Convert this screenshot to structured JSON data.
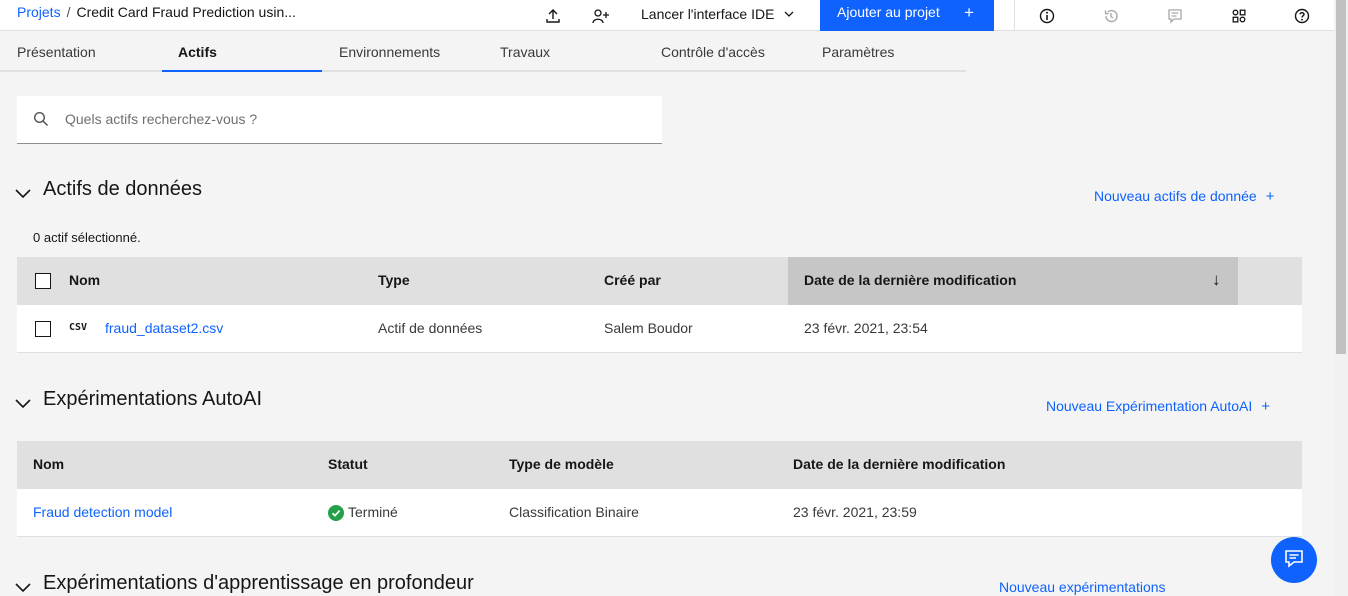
{
  "breadcrumb": {
    "root": "Projets",
    "separator": "/",
    "project": "Credit Card Fraud Prediction usin..."
  },
  "header": {
    "launch_ide": "Lancer l'interface IDE",
    "add_to_project": "Ajouter au projet",
    "add_icon": "+",
    "icons": [
      "upload-icon",
      "add-user-icon",
      "info-icon",
      "history-icon",
      "comment-icon",
      "apps-icon",
      "help-icon"
    ]
  },
  "tabs": [
    {
      "label": "Présentation"
    },
    {
      "label": "Actifs"
    },
    {
      "label": "Environnements"
    },
    {
      "label": "Travaux"
    },
    {
      "label": "Contrôle d'accès"
    },
    {
      "label": "Paramètres"
    }
  ],
  "active_tab": "Actifs",
  "search": {
    "placeholder": "Quels actifs recherchez-vous ?"
  },
  "data_assets": {
    "title": "Actifs de données",
    "new_link": "Nouveau actifs de donnée",
    "plus": "+",
    "selected_count": "0 actif sélectionné.",
    "columns": {
      "name": "Nom",
      "type": "Type",
      "created_by": "Créé par",
      "modified": "Date de la dernière modification"
    },
    "sort_icon": "↓",
    "rows": [
      {
        "badge": "CSV",
        "name": "fraud_dataset2.csv",
        "type": "Actif de données",
        "created_by": "Salem Boudor",
        "modified": "23 févr. 2021, 23:54"
      }
    ]
  },
  "autoai": {
    "title": "Expérimentations AutoAI",
    "new_link": "Nouveau Expérimentation AutoAI",
    "plus": "+",
    "columns": {
      "name": "Nom",
      "status": "Statut",
      "model_type": "Type de modèle",
      "modified": "Date de la dernière modification"
    },
    "rows": [
      {
        "name": "Fraud detection model",
        "status": "Terminé",
        "model_type": "Classification Binaire",
        "modified": "23 févr. 2021, 23:59"
      }
    ]
  },
  "deep_learning": {
    "title": "Expérimentations d'apprentissage en profondeur",
    "new_link": "Nouveau expérimentations"
  },
  "colors": {
    "accent": "#0f62fe",
    "success": "#24a148",
    "header_bg": "#e0e0e0"
  }
}
